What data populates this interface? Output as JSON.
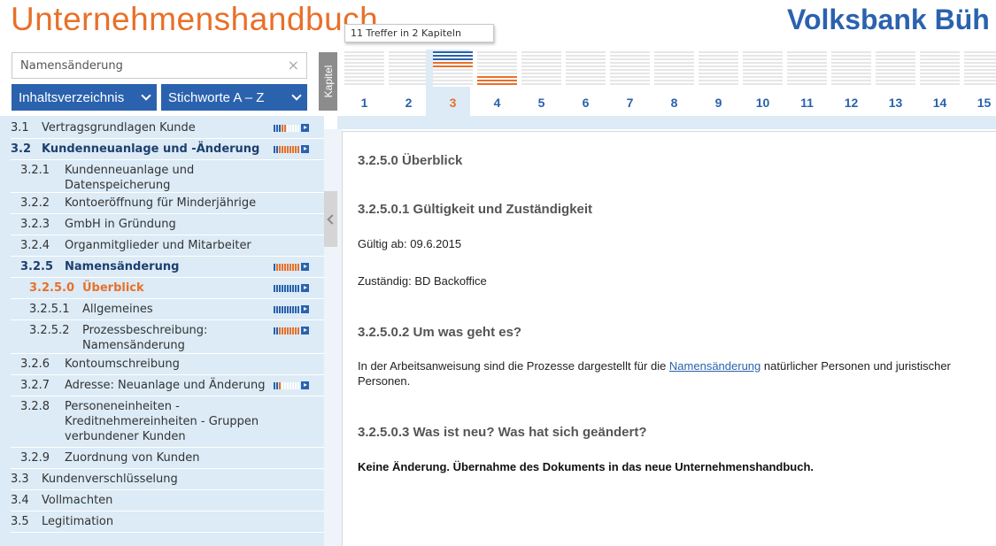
{
  "header": {
    "app_title": "Unternehmenshandbuch",
    "bank_name": "Volksbank Büh",
    "tooltip": "11 Treffer in 2 Kapiteln"
  },
  "search": {
    "value": "Namensänderung",
    "clear_label": "×"
  },
  "nav": {
    "toc_label": "Inhaltsverzeichnis",
    "keywords_label": "Stichworte A – Z",
    "chapter_label": "Kapitel"
  },
  "chapters": [
    "1",
    "2",
    "3",
    "4",
    "5",
    "6",
    "7",
    "8",
    "9",
    "10",
    "11",
    "12",
    "13",
    "14",
    "15"
  ],
  "active_chapter": "3",
  "chapter_hits": {
    "3": {
      "blue": 1,
      "orange": 1
    },
    "4": {
      "orange": 1
    }
  },
  "toc": [
    {
      "num": "3.1",
      "title": "Vertragsgrundlagen Kunde",
      "level": 1,
      "style": "normal",
      "hits": {
        "blue": 3,
        "orange": 2,
        "empty": 5
      }
    },
    {
      "num": "3.2",
      "title": "Kundenneuanlage und -Änderung",
      "level": 1,
      "style": "bold",
      "hits": {
        "blue": 2,
        "orange": 8,
        "empty": 0
      }
    },
    {
      "num": "3.2.1",
      "title": "Kundenneuanlage und Datenspeicherung",
      "level": 2,
      "style": "normal"
    },
    {
      "num": "3.2.2",
      "title": "Kontoeröffnung für Minderjährige",
      "level": 2,
      "style": "normal"
    },
    {
      "num": "3.2.3",
      "title": "GmbH in Gründung",
      "level": 2,
      "style": "normal"
    },
    {
      "num": "3.2.4",
      "title": "Organmitglieder und Mitarbeiter",
      "level": 2,
      "style": "normal"
    },
    {
      "num": "3.2.5",
      "title": "Namensänderung",
      "level": 2,
      "style": "bold",
      "hits": {
        "blue": 1,
        "orange": 9,
        "empty": 0
      }
    },
    {
      "num": "3.2.5.0",
      "title": "Überblick",
      "level": 3,
      "style": "current",
      "hits": {
        "blue": 10,
        "orange": 0,
        "empty": 0
      }
    },
    {
      "num": "3.2.5.1",
      "title": "Allgemeines",
      "level": 3,
      "style": "normal",
      "hits": {
        "blue": 10,
        "orange": 0,
        "empty": 0
      }
    },
    {
      "num": "3.2.5.2",
      "title": "Prozessbeschreibung: Namensänderung",
      "level": 3,
      "style": "normal",
      "hits": {
        "blue": 2,
        "orange": 8,
        "empty": 0
      }
    },
    {
      "num": "3.2.6",
      "title": "Kontoumschreibung",
      "level": 2,
      "style": "normal"
    },
    {
      "num": "3.2.7",
      "title": "Adresse: Neuanlage und Änderung",
      "level": 2,
      "style": "normal",
      "hits": {
        "blue": 2,
        "orange": 1,
        "empty": 7
      }
    },
    {
      "num": "3.2.8",
      "title": "Personeneinheiten - Kreditnehmereinheiten - Gruppen verbundener Kunden",
      "level": 2,
      "style": "normal"
    },
    {
      "num": "3.2.9",
      "title": "Zuordnung von Kunden",
      "level": 2,
      "style": "normal"
    },
    {
      "num": "3.3",
      "title": "Kundenverschlüsselung",
      "level": 1,
      "style": "normal"
    },
    {
      "num": "3.4",
      "title": "Vollmachten",
      "level": 1,
      "style": "normal"
    },
    {
      "num": "3.5",
      "title": "Legitimation",
      "level": 1,
      "style": "normal"
    }
  ],
  "content": {
    "heading": "3.2.5.0  Überblick",
    "section1_title": "3.2.5.0.1 Gültigkeit und Zuständigkeit",
    "valid_from": "Gültig ab: 09.6.2015",
    "responsible": "Zuständig: BD Backoffice",
    "section2_title": "3.2.5.0.2 Um was geht es?",
    "section2_text_before": "In der Arbeitsanweisung sind die Prozesse dargestellt für die ",
    "section2_link": "Namensänderung",
    "section2_text_after": " natürlicher Personen und juristischer Personen.",
    "section3_title": "3.2.5.0.3 Was ist neu? Was hat sich geändert?",
    "section3_text": "Keine Änderung. Übernahme des Dokuments in das neue Unternehmenshandbuch."
  },
  "colors": {
    "accent_blue": "#2a62ae",
    "accent_orange": "#e8702a",
    "sidebar_bg": "#dcebf6"
  }
}
